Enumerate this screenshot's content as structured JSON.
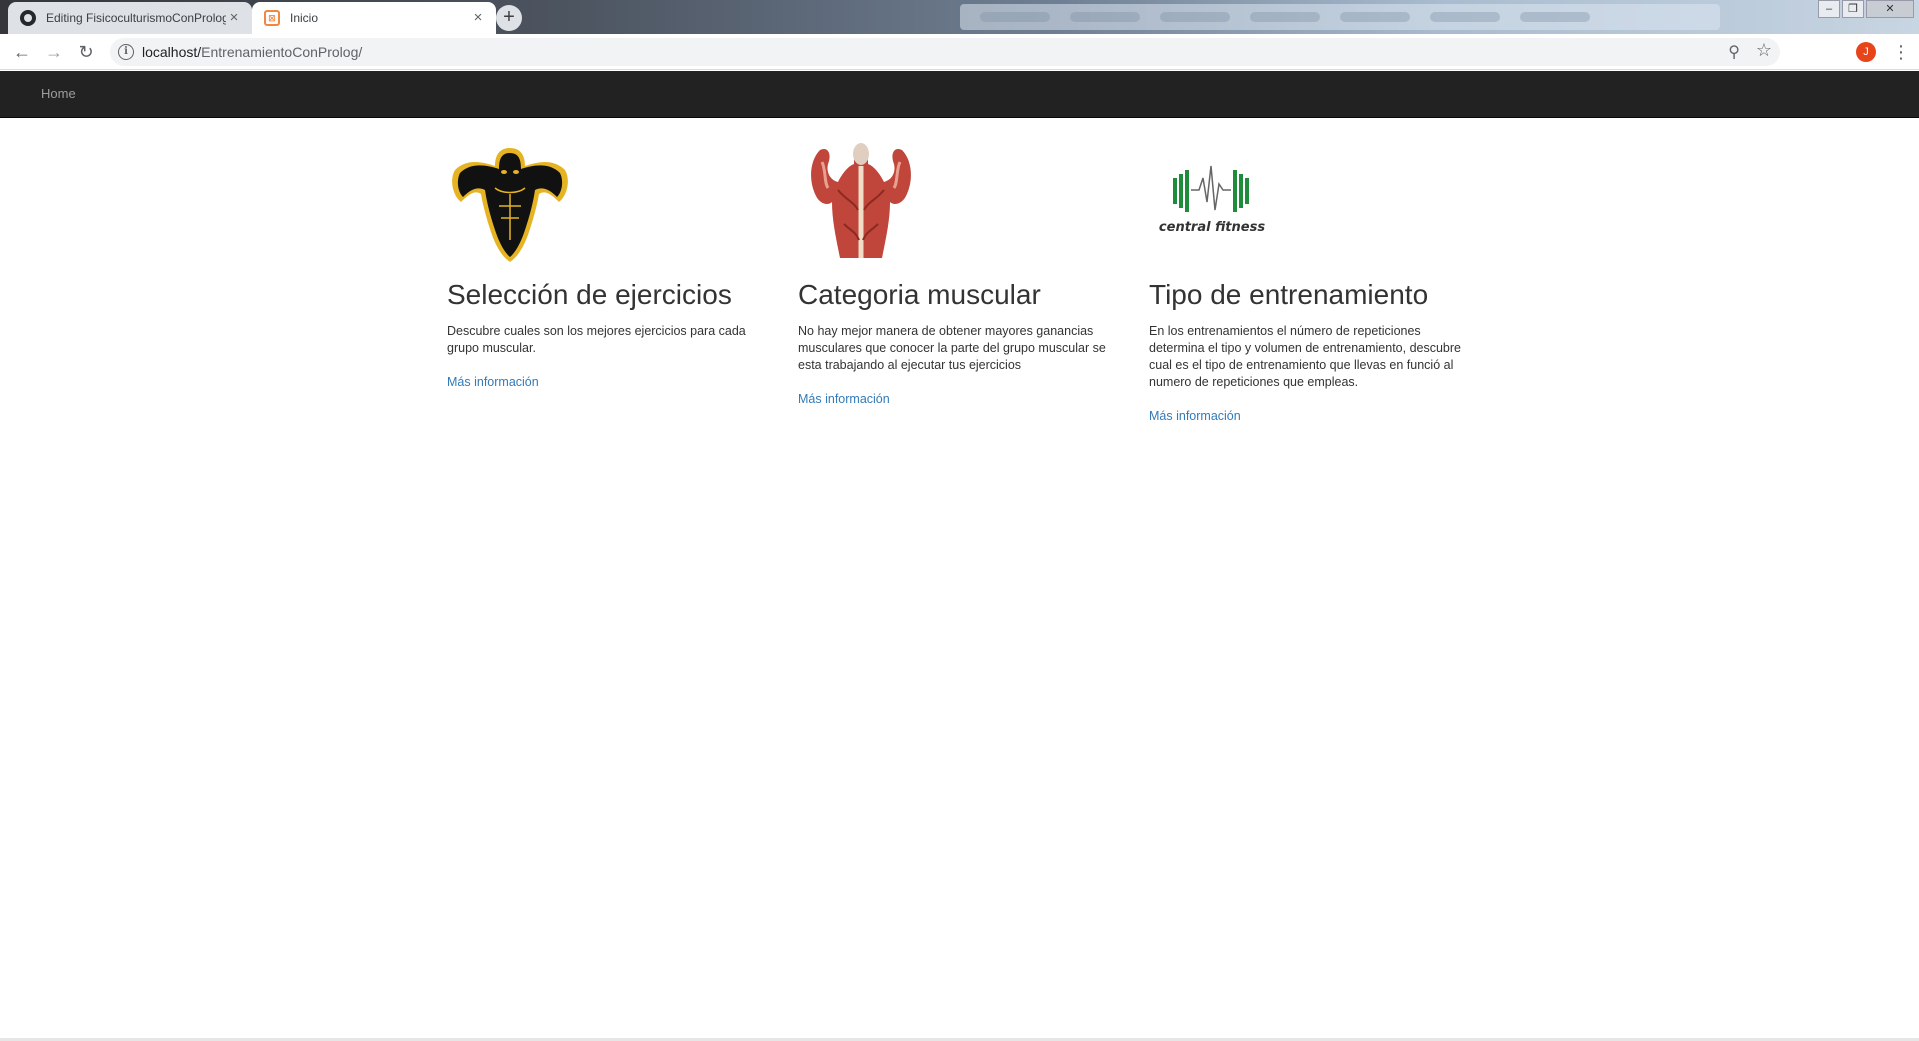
{
  "browser": {
    "tabs": [
      {
        "title": "Editing FisicoculturismoConProlog",
        "close": "×"
      },
      {
        "title": "Inicio",
        "close": "×"
      }
    ],
    "new_tab": "+",
    "url_host": "localhost/",
    "url_path": "EntrenamientoConProlog/",
    "info_icon": "i",
    "avatar_letter": "J"
  },
  "navbar": {
    "home": "Home"
  },
  "columns": [
    {
      "title": "Selección de ejercicios",
      "text": "Descubre cuales son los mejores ejercicios para cada grupo muscular.",
      "link": "Más información"
    },
    {
      "title": "Categoria muscular",
      "text": "No hay mejor manera de obtener mayores ganancias musculares que conocer la parte del grupo muscular se esta trabajando al ejecutar tus ejercicios",
      "link": "Más información"
    },
    {
      "title": "Tipo de entrenamiento",
      "text": "En los entrenamientos el número de repeticiones determina el tipo y volumen de entrenamiento, descubre cual es el tipo de entrenamiento que llevas en funció al numero de repeticiones que empleas.",
      "link": "Más información"
    }
  ],
  "logo_text": "central fitness",
  "colors": {
    "navbar": "#222222",
    "link": "#337ab7",
    "logo_green": "#1e8c3a",
    "muscle_red": "#c0453a",
    "gold": "#e6b422"
  }
}
